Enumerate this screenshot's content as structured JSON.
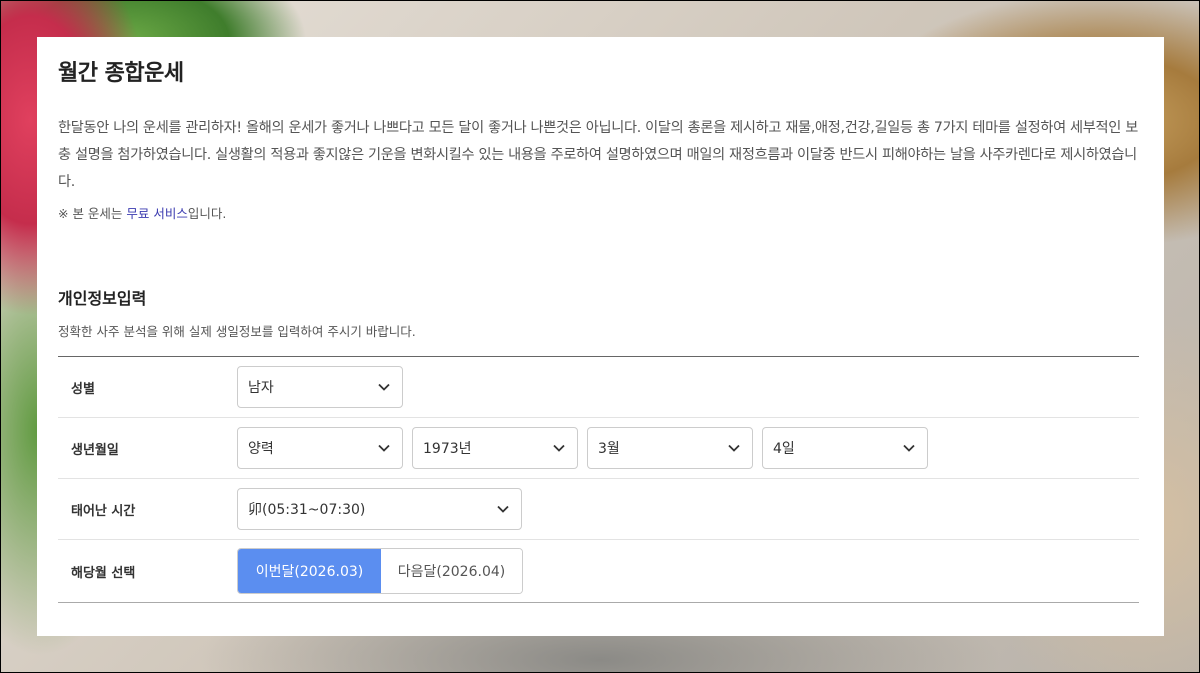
{
  "colors": {
    "accent": "#5b8ef0",
    "link": "#3b3bb0"
  },
  "header": {
    "title": "월간 종합운세",
    "intro": "한달동안 나의 운세를 관리하자! 올해의 운세가 좋거나 나쁘다고 모든 달이 좋거나 나쁜것은 아닙니다. 이달의 총론을 제시하고 재물,애정,건강,길일등 총 7가지 테마를 설정하여 세부적인 보충 설명을 첨가하였습니다. 실생활의 적용과 좋지않은 기운을 변화시킬수 있는 내용을 주로하여 설명하였으며 매일의 재정흐름과 이달중 반드시 피해야하는 날을 사주카렌다로 제시하였습니다.",
    "notice_prefix": "※ 본 운세는 ",
    "notice_link": "무료 서비스",
    "notice_suffix": "입니다."
  },
  "form": {
    "section_title": "개인정보입력",
    "section_desc": "정확한 사주 분석을 위해 실제 생일정보를 입력하여 주시기 바랍니다.",
    "gender": {
      "label": "성별",
      "value": "남자",
      "icon": "chevron-down-icon"
    },
    "birth": {
      "label": "생년월일",
      "calendar": "양력",
      "year": "1973년",
      "month": "3월",
      "day": "4일"
    },
    "time": {
      "label": "태어난 시간",
      "value": "卯(05:31~07:30)"
    },
    "month_select": {
      "label": "해당월 선택",
      "current": "이번달(2026.03)",
      "next": "다음달(2026.04)",
      "selected": "current"
    }
  }
}
